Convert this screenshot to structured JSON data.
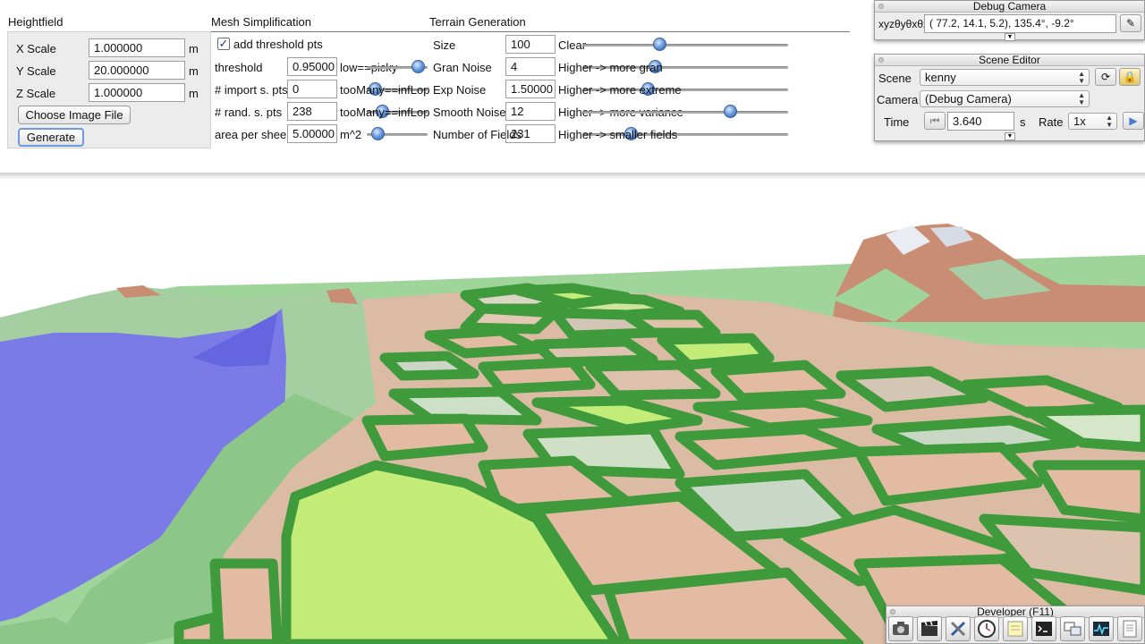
{
  "heightfield": {
    "title": "Heightfield",
    "rows": [
      {
        "label": "X Scale",
        "value": "1.000000",
        "unit": "m"
      },
      {
        "label": "Y Scale",
        "value": "20.000000",
        "unit": "m"
      },
      {
        "label": "Z Scale",
        "value": "1.000000",
        "unit": "m"
      }
    ],
    "choose_button": "Choose Image File",
    "generate_button": "Generate"
  },
  "mesh": {
    "title": "Mesh Simplification",
    "checkbox_label": "add threshold pts",
    "checkbox_checked": true,
    "rows": [
      {
        "label": "threshold",
        "value": "0.95000",
        "hint": "low==picky",
        "slider": 0.85
      },
      {
        "label": "# import s. pts",
        "value": "0",
        "hint": "tooMany==infLop",
        "slider": 0.0
      },
      {
        "label": "# rand. s. pts",
        "value": "238",
        "hint": "tooMany==infLop",
        "slider": 0.1
      },
      {
        "label": "area per sheep",
        "value": "5.00000",
        "hint": "m^2",
        "slider": 0.1
      }
    ]
  },
  "terrain": {
    "title": "Terrain Generation",
    "rows": [
      {
        "label": "Size",
        "value": "100",
        "hint": "Clear",
        "slider": 0.37
      },
      {
        "label": "Gran Noise",
        "value": "4",
        "hint": "Higher -> more gran",
        "slider": 0.33
      },
      {
        "label": "Exp Noise",
        "value": "1.50000",
        "hint": "Higher -> more extreme",
        "slider": 0.29
      },
      {
        "label": "Smooth Noise",
        "value": "12",
        "hint": "Higher -> more variance",
        "slider": 0.71
      },
      {
        "label": "Number of Fields",
        "value": "231",
        "hint": "Higher -> smaller fields",
        "slider": 0.23
      }
    ]
  },
  "debug_camera": {
    "title": "Debug Camera",
    "label": "xyzθyθxθz",
    "value": "( 77.2,  14.1,   5.2),  135.4°,  -9.2°"
  },
  "scene_editor": {
    "title": "Scene Editor",
    "scene_label": "Scene",
    "scene_value": "kenny",
    "camera_label": "Camera",
    "camera_value": "(Debug Camera)",
    "time_label": "Time",
    "time_value": "3.640",
    "time_unit": "s",
    "rate_label": "Rate",
    "rate_value": "1x"
  },
  "developer": {
    "title": "Developer (F11)",
    "tools": [
      "camera-icon",
      "clapperboard-icon",
      "tools-icon",
      "clock-icon",
      "note-icon",
      "terminal-icon",
      "windows-icon",
      "profiler-icon",
      "document-icon"
    ]
  },
  "colors": {
    "field_border": "#3e9a3a",
    "grass": "#9fd49b",
    "water": "#7b7be8",
    "sky": "#ffffff",
    "field_light": "#c3ec78",
    "field_tan": "#e3bba3",
    "mountain": "#c98d73"
  }
}
